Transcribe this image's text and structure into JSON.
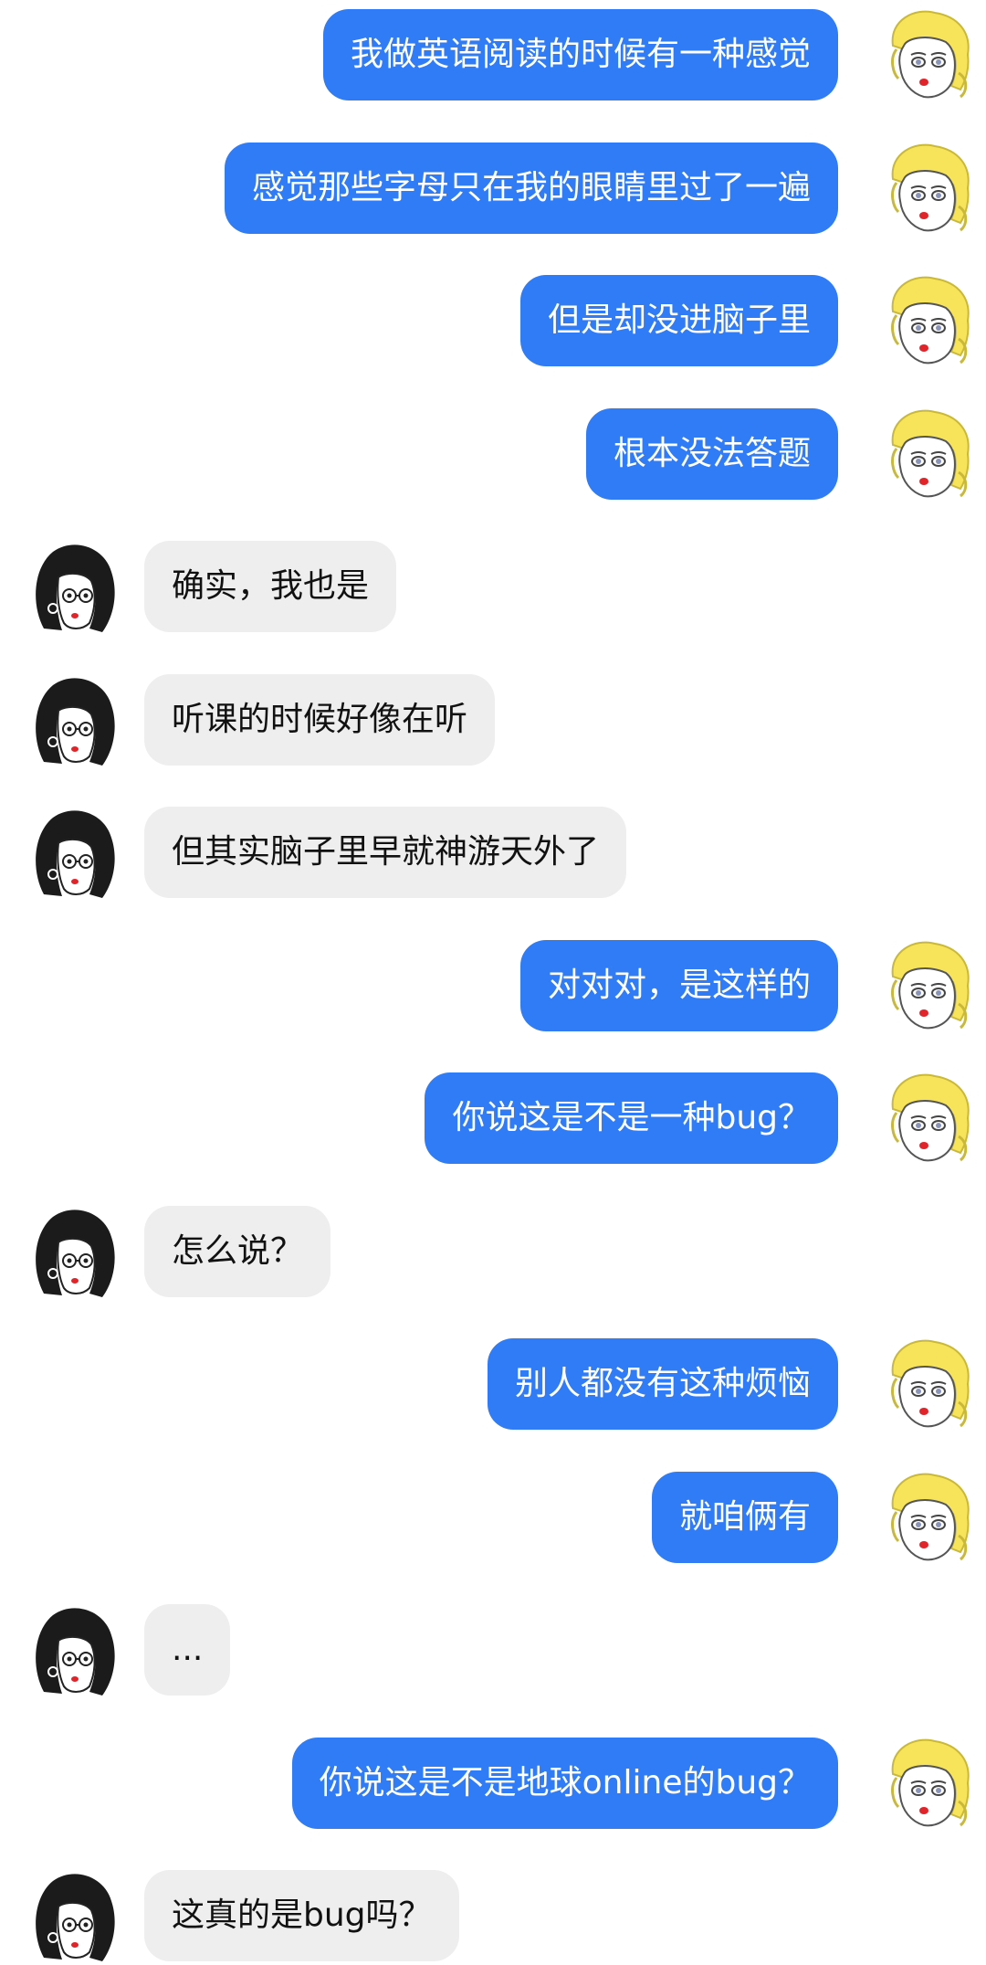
{
  "colors": {
    "self_bubble": "#2f7cf6",
    "self_text": "#ffffff",
    "other_bubble": "#eeeeee",
    "other_text": "#111111"
  },
  "messages": [
    {
      "side": "right",
      "avatar": "blonde-avatar",
      "text": "我做英语阅读的时候有一种感觉"
    },
    {
      "side": "right",
      "avatar": "blonde-avatar",
      "text": "感觉那些字母只在我的眼睛里过了一遍"
    },
    {
      "side": "right",
      "avatar": "blonde-avatar",
      "text": "但是却没进脑子里"
    },
    {
      "side": "right",
      "avatar": "blonde-avatar",
      "text": "根本没法答题"
    },
    {
      "side": "left",
      "avatar": "dark-hair-avatar",
      "text": "确实，我也是"
    },
    {
      "side": "left",
      "avatar": "dark-hair-avatar",
      "text": "听课的时候好像在听"
    },
    {
      "side": "left",
      "avatar": "dark-hair-avatar",
      "text": "但其实脑子里早就神游天外了"
    },
    {
      "side": "right",
      "avatar": "blonde-avatar",
      "text": "对对对，是这样的"
    },
    {
      "side": "right",
      "avatar": "blonde-avatar",
      "text": "你说这是不是一种bug？"
    },
    {
      "side": "left",
      "avatar": "dark-hair-avatar",
      "text": "怎么说？"
    },
    {
      "side": "right",
      "avatar": "blonde-avatar",
      "text": "别人都没有这种烦恼"
    },
    {
      "side": "right",
      "avatar": "blonde-avatar",
      "text": "就咱俩有"
    },
    {
      "side": "left",
      "avatar": "dark-hair-avatar",
      "text": "..."
    },
    {
      "side": "right",
      "avatar": "blonde-avatar",
      "text": "你说这是不是地球online的bug？"
    },
    {
      "side": "left",
      "avatar": "dark-hair-avatar",
      "text": "这真的是bug吗？"
    }
  ]
}
